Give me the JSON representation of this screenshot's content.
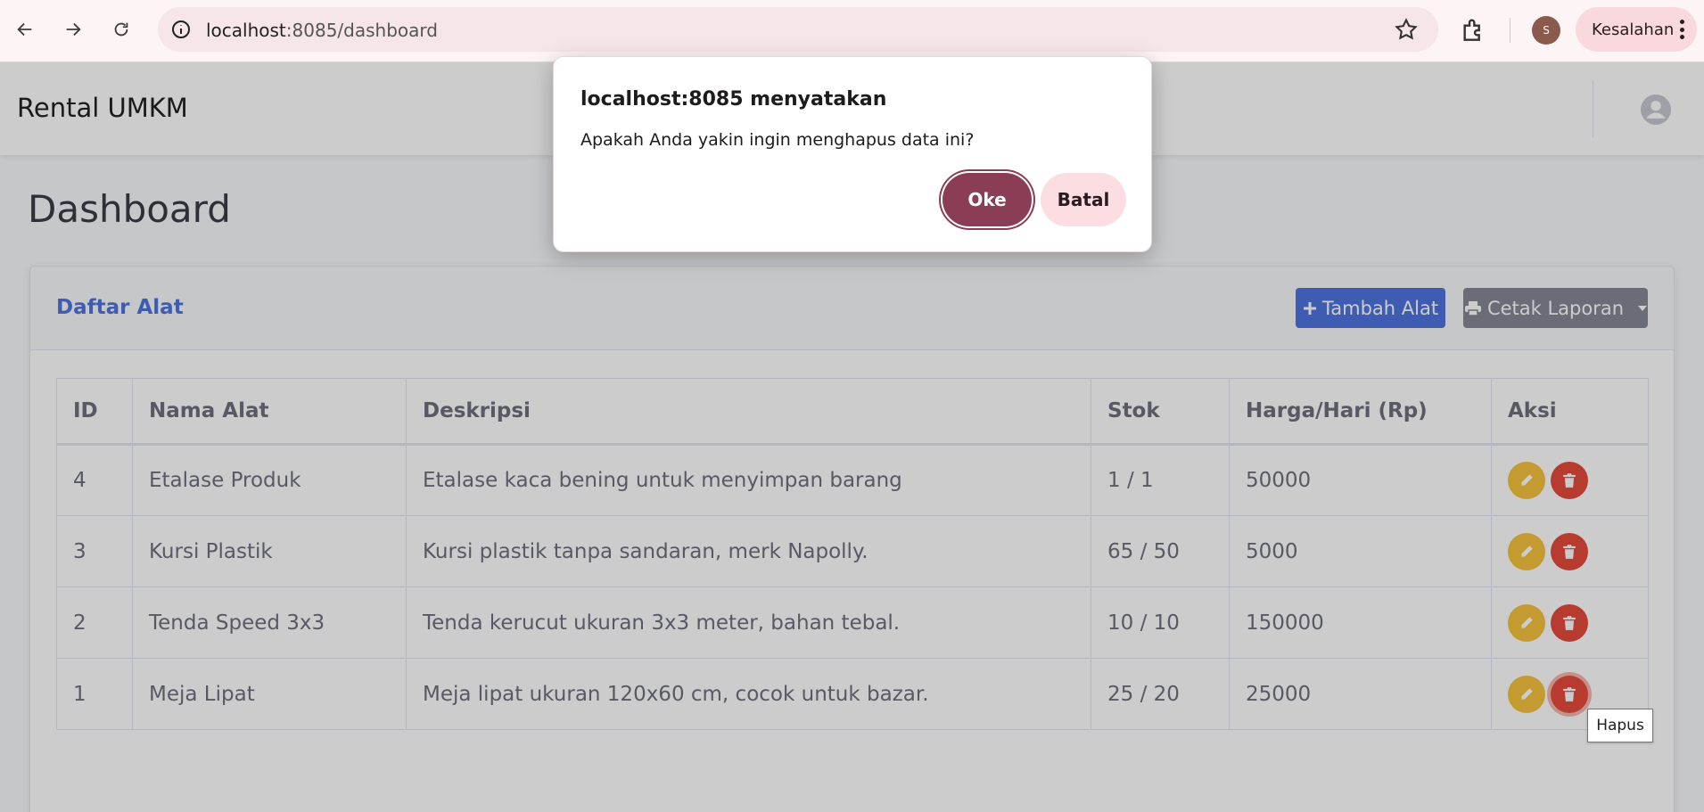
{
  "browser": {
    "url_host": "localhost",
    "url_rest": ":8085/dashboard",
    "profile_initial": "S",
    "error_label": "Kesalahan"
  },
  "app": {
    "brand": "Rental UMKM",
    "page_title": "Dashboard",
    "card_title": "Daftar Alat",
    "add_button": "Tambah Alat",
    "print_button": "Cetak Laporan"
  },
  "table": {
    "headers": [
      "ID",
      "Nama Alat",
      "Deskripsi",
      "Stok",
      "Harga/Hari (Rp)",
      "Aksi"
    ],
    "rows": [
      {
        "id": "4",
        "nama": "Etalase Produk",
        "deskripsi": "Etalase kaca bening untuk menyimpan barang",
        "stok": "1 / 1",
        "harga": "50000"
      },
      {
        "id": "3",
        "nama": "Kursi Plastik",
        "deskripsi": "Kursi plastik tanpa sandaran, merk Napolly.",
        "stok": "65 / 50",
        "harga": "5000"
      },
      {
        "id": "2",
        "nama": "Tenda Speed 3x3",
        "deskripsi": "Tenda kerucut ukuran 3x3 meter, bahan tebal.",
        "stok": "10 / 10",
        "harga": "150000"
      },
      {
        "id": "1",
        "nama": "Meja Lipat",
        "deskripsi": "Meja lipat ukuran 120x60 cm, cocok untuk bazar.",
        "stok": "25 / 20",
        "harga": "25000"
      }
    ]
  },
  "tooltip": "Hapus",
  "dialog": {
    "title": "localhost:8085 menyatakan",
    "message": "Apakah Anda yakin ingin menghapus data ini?",
    "ok_label": "Oke",
    "cancel_label": "Batal"
  },
  "colors": {
    "primary": "#4e73df",
    "secondary": "#858796",
    "warning": "#f6c23e",
    "danger": "#e74a3b",
    "dialog_accent": "#8b3d56"
  }
}
